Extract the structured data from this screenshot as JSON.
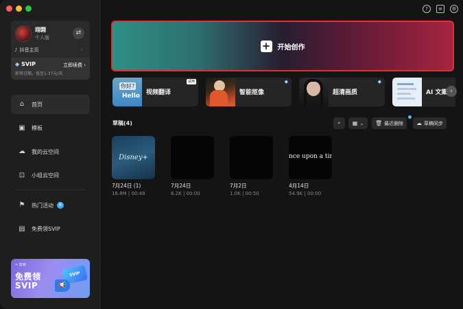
{
  "profile": {
    "username": "翊翾",
    "account_type": "个人版",
    "douyin_home": "抖音主页",
    "svip_label": "SVIP",
    "renew_label": "立即续费",
    "expire_text": "即将过期，低至1.37元/天"
  },
  "nav": {
    "home": "首页",
    "templates": "模板",
    "my_cloud": "我的云空间",
    "team_cloud": "小组云空间",
    "events": "热门活动",
    "events_badge": "6",
    "free_svip": "免费领SVIP"
  },
  "promo": {
    "logo_text": "✂ 剪映",
    "line1": "免费领",
    "line2": "SVIP",
    "card_text": "SVIP"
  },
  "main": {
    "start_label": "开始创作",
    "drafts_title": "草稿(4)",
    "recently_deleted": "最近删除",
    "draft_sync": "草稿同步"
  },
  "tools": [
    {
      "label": "视频翻译",
      "tag": "试用",
      "thumb_text_top": "你好?",
      "thumb_text_bottom": "Hello"
    },
    {
      "label": "智能抠像",
      "tag": "◆"
    },
    {
      "label": "超清画质",
      "tag": "◆"
    },
    {
      "label": "AI 文案成片",
      "tag": ""
    }
  ],
  "drafts": [
    {
      "name": "7月24日 (1)",
      "size": "16.8M",
      "duration": "00:48",
      "thumb_text": "Disney+"
    },
    {
      "name": "7月24日",
      "size": "6.2K",
      "duration": "00:00",
      "thumb_text": ""
    },
    {
      "name": "7月2日",
      "size": "1.0K",
      "duration": "00:50",
      "thumb_text": ""
    },
    {
      "name": "4月14日",
      "size": "54.9K",
      "duration": "00:00",
      "thumb_text": "nce upon a tin"
    }
  ],
  "colors": {
    "accent_border": "#e3312f",
    "sidebar_bg": "#1e1e1e",
    "main_bg": "#141414"
  }
}
